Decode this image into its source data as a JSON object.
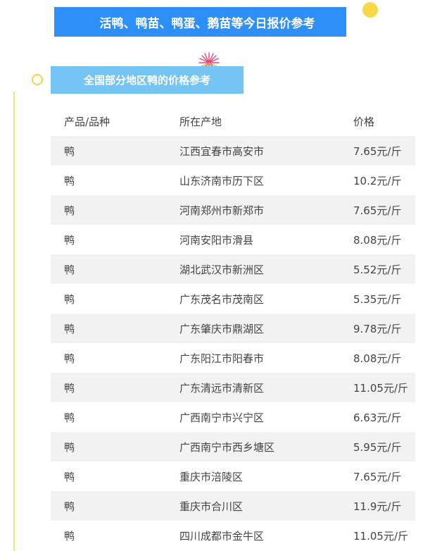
{
  "header": {
    "title": "活鸭、鸭苗、鸭蛋、鹅苗等今日报价参考"
  },
  "section": {
    "title": "全国部分地区鸭的价格参考"
  },
  "table": {
    "columns": [
      "产品/品种",
      "所在产地",
      "价格"
    ],
    "rows": [
      [
        "鸭",
        "江西宜春市高安市",
        "7.65元/斤"
      ],
      [
        "鸭",
        "山东济南市历下区",
        "10.2元/斤"
      ],
      [
        "鸭",
        "河南郑州市新郑市",
        "7.65元/斤"
      ],
      [
        "鸭",
        "河南安阳市滑县",
        "8.08元/斤"
      ],
      [
        "鸭",
        "湖北武汉市新洲区",
        "5.52元/斤"
      ],
      [
        "鸭",
        "广东茂名市茂南区",
        "5.35元/斤"
      ],
      [
        "鸭",
        "广东肇庆市鼎湖区",
        "9.78元/斤"
      ],
      [
        "鸭",
        "广东阳江市阳春市",
        "8.08元/斤"
      ],
      [
        "鸭",
        "广东清远市清新区",
        "11.05元/斤"
      ],
      [
        "鸭",
        "广西南宁市兴宁区",
        "6.63元/斤"
      ],
      [
        "鸭",
        "广西南宁市西乡塘区",
        "5.95元/斤"
      ],
      [
        "鸭",
        "重庆市涪陵区",
        "7.65元/斤"
      ],
      [
        "鸭",
        "重庆市合川区",
        "11.9元/斤"
      ],
      [
        "鸭",
        "四川成都市金牛区",
        "11.05元/斤"
      ]
    ]
  },
  "colors": {
    "banner": "#2f8ff8",
    "subtitle": "#74c4f4",
    "accent": "#f8d84a",
    "firework": "#e0457a"
  },
  "icons": [
    "yellow-dot-icon",
    "firework-icon",
    "ring-icon"
  ]
}
